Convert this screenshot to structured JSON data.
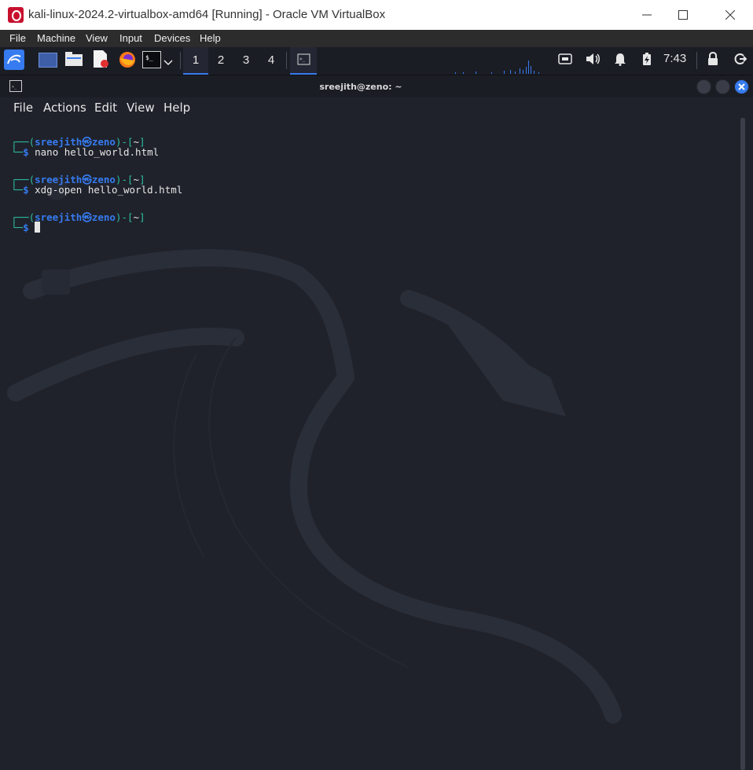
{
  "window": {
    "title": "kali-linux-2024.2-virtualbox-amd64 [Running] - Oracle VM VirtualBox"
  },
  "vbox_menu": [
    "File",
    "Machine",
    "View",
    "Input",
    "Devices",
    "Help"
  ],
  "panel": {
    "workspaces": [
      "1",
      "2",
      "3",
      "4"
    ],
    "active_workspace": "1",
    "clock": "7:43",
    "launchers": [
      "kali-menu-icon",
      "desktop-icon",
      "file-manager-icon",
      "text-editor-icon",
      "firefox-icon",
      "terminal-icon"
    ]
  },
  "terminal": {
    "title": "sreejith@zeno: ~",
    "menu": [
      "File",
      "Actions",
      "Edit",
      "View",
      "Help"
    ],
    "prompts": [
      {
        "user": "sreejith",
        "sep": "㉿",
        "host": "zeno",
        "dir": "~",
        "command": "nano hello_world.html"
      },
      {
        "user": "sreejith",
        "sep": "㉿",
        "host": "zeno",
        "dir": "~",
        "command": "xdg-open hello_world.html"
      },
      {
        "user": "sreejith",
        "sep": "㉿",
        "host": "zeno",
        "dir": "~",
        "command": ""
      }
    ]
  },
  "colors": {
    "accent": "#367bf0",
    "prompt_bracket": "#2dbea1",
    "terminal_bg": "#1f222b",
    "panel_bg": "#1b1d25"
  }
}
